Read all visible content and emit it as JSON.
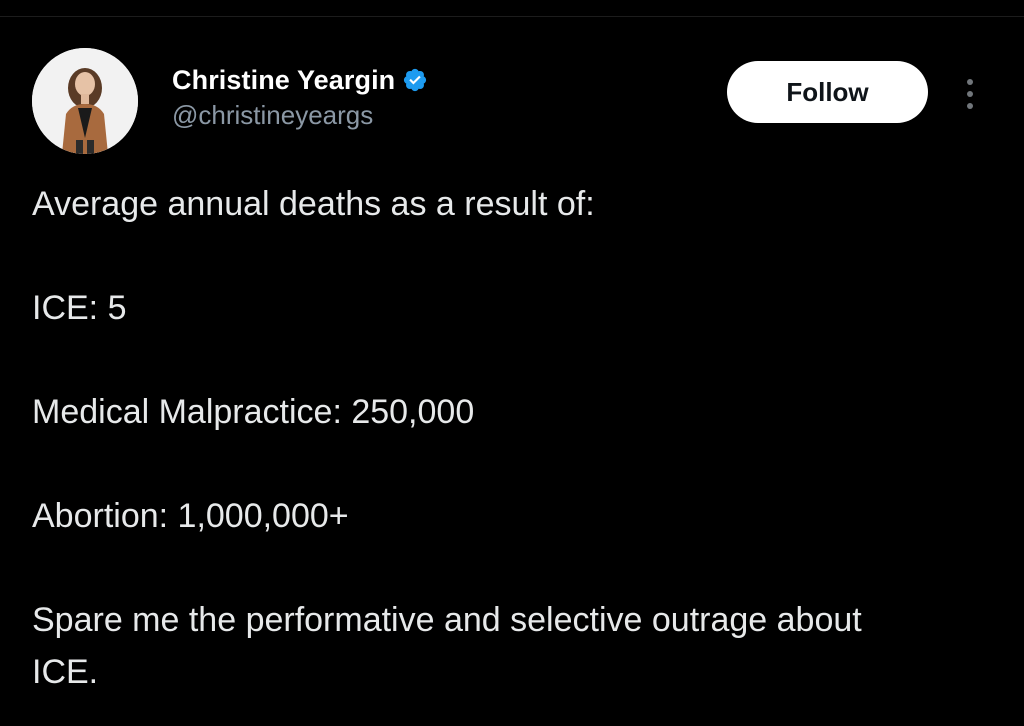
{
  "author": {
    "display_name": "Christine Yeargin",
    "handle": "@christineyeargs",
    "verified_color": "#1d9bf0",
    "avatar_icon": "profile-photo"
  },
  "actions": {
    "follow_label": "Follow",
    "more_icon": "more-options-vertical"
  },
  "tweet": {
    "paragraphs": [
      "Average annual deaths as a result of:",
      "ICE: 5",
      "Medical Malpractice: 250,000",
      "Abortion: 1,000,000+",
      "Spare me the performative and selective outrage about ICE."
    ]
  },
  "colors": {
    "background": "#000000",
    "text": "#e7e9ea",
    "secondary_text": "#8b98a5",
    "button_bg": "#ffffff",
    "button_text": "#0f1419"
  }
}
